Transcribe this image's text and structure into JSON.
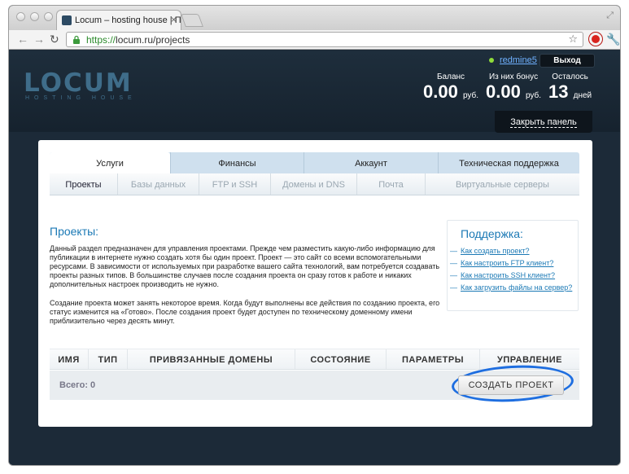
{
  "browser": {
    "tab_title": "Locum – hosting house | Пр",
    "url_scheme": "https://",
    "url_rest": "locum.ru/projects"
  },
  "header": {
    "logo": "LOCUM",
    "logo_sub": "HOSTING HOUSE",
    "username": "redmine5",
    "logout": "Выход",
    "balance_label": "Баланс",
    "balance_value": "0.00",
    "balance_unit": "руб.",
    "bonus_label": "Из них бонус",
    "bonus_value": "0.00",
    "bonus_unit": "руб.",
    "remaining_label": "Осталось",
    "remaining_value": "13",
    "remaining_unit": "дней",
    "close_panel": "Закрыть панель"
  },
  "tabs": [
    "Услуги",
    "Финансы",
    "Аккаунт",
    "Техническая поддержка"
  ],
  "subtabs": [
    "Проекты",
    "Базы данных",
    "FTP и SSH",
    "Домены и DNS",
    "Почта",
    "Виртуальные серверы"
  ],
  "main": {
    "title": "Проекты:",
    "para1": "Данный раздел предназначен для управления проектами. Прежде чем разместить какую-либо информацию для публикации в интернете нужно создать хотя бы один проект. Проект — это сайт со всеми вспомогательными ресурсами. В зависимости от используемых при разработке вашего сайта технологий, вам потребуется создавать проекты разных типов. В большинстве случаев после создания проекта он сразу готов к работе и никаких дополнительных настроек производить не нужно.",
    "para2": "Создание проекта может занять некоторое время. Когда будут выполнены все действия по созданию проекта, его статус изменится на «Готово». После создания проект будет доступен по техническому доменному имени приблизительно через десять минут."
  },
  "support": {
    "title": "Поддержка:",
    "links": [
      "Как создать проект?",
      "Как настроить FTP клиент?",
      "Как настроить SSH клиент?",
      "Как загрузить файлы на сервер?"
    ]
  },
  "table": {
    "columns": [
      "ИМЯ",
      "ТИП",
      "ПРИВЯЗАННЫЕ ДОМЕНЫ",
      "СОСТОЯНИЕ",
      "ПАРАМЕТРЫ",
      "УПРАВЛЕНИЕ"
    ],
    "total": "Всего: 0",
    "create_button": "СОЗДАТЬ ПРОЕКТ"
  }
}
